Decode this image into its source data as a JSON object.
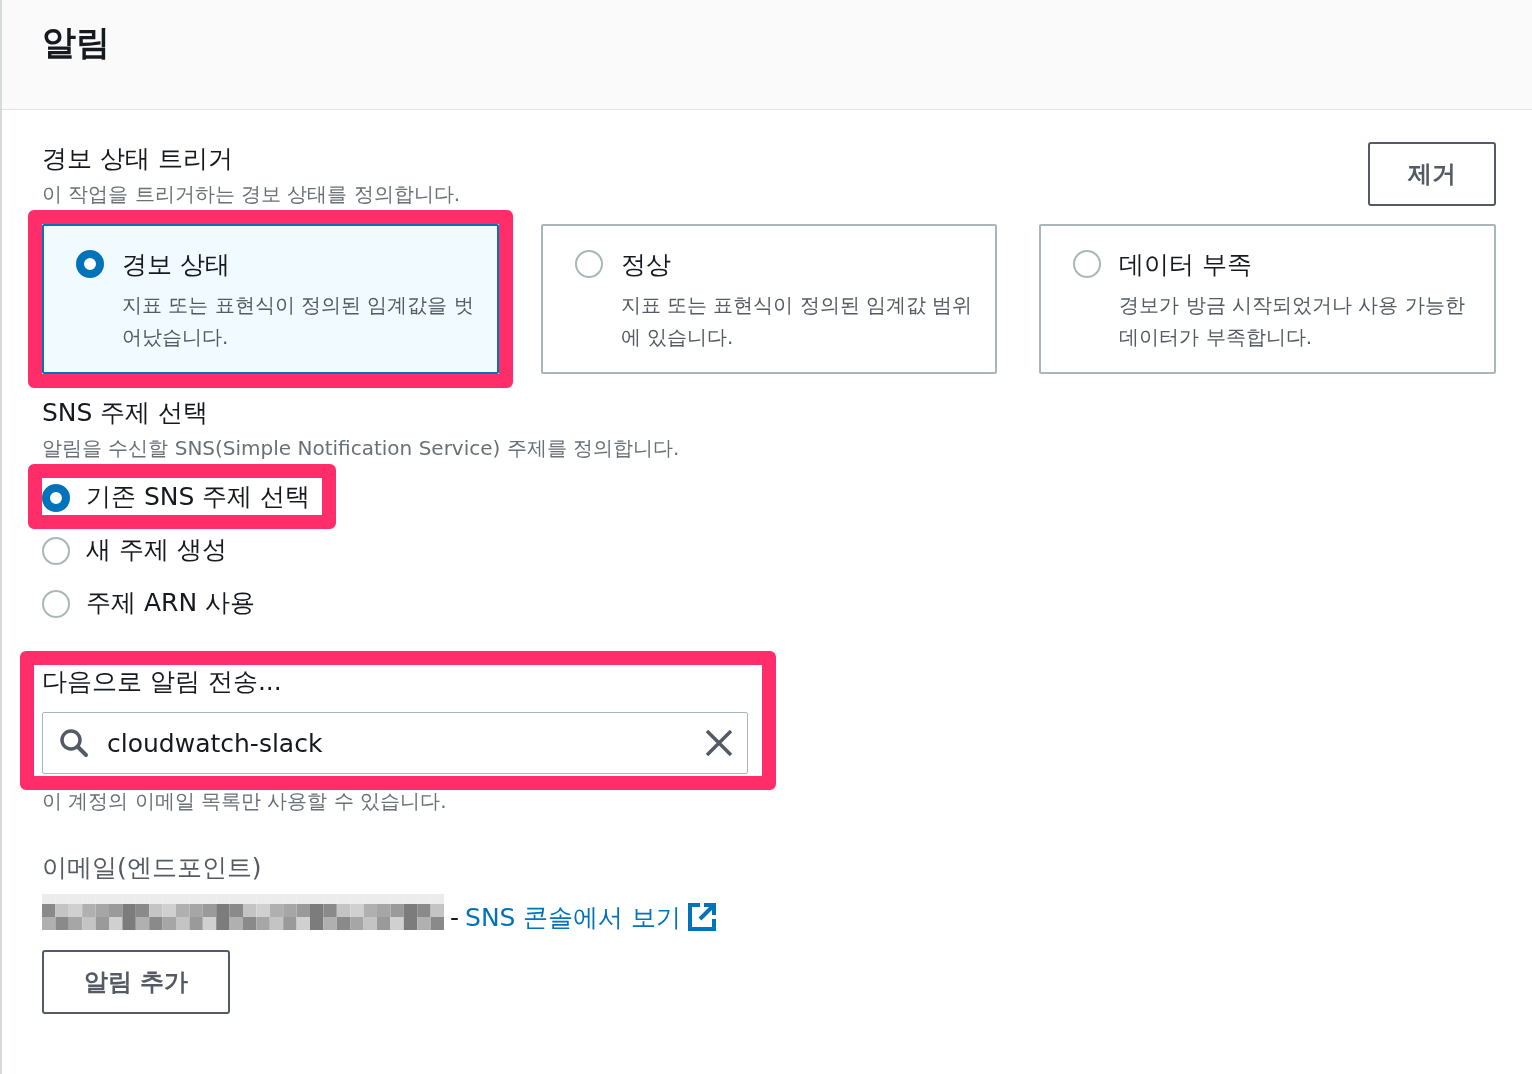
{
  "panel": {
    "title": "알림"
  },
  "trigger": {
    "label": "경보 상태 트리거",
    "description": "이 작업을 트리거하는 경보 상태를 정의합니다.",
    "remove_button": "제거",
    "options": [
      {
        "title": "경보 상태",
        "description": "지표 또는 표현식이 정의된 임계값을 벗어났습니다.",
        "selected": true,
        "highlighted": true
      },
      {
        "title": "정상",
        "description": "지표 또는 표현식이 정의된 임계값 범위에 있습니다.",
        "selected": false,
        "highlighted": false
      },
      {
        "title": "데이터 부족",
        "description": "경보가 방금 시작되었거나 사용 가능한 데이터가 부족합니다.",
        "selected": false,
        "highlighted": false
      }
    ]
  },
  "sns_topic": {
    "label": "SNS 주제 선택",
    "description": "알림을 수신할 SNS(Simple Notification Service) 주제를 정의합니다.",
    "options": [
      {
        "label": "기존 SNS 주제 선택",
        "selected": true,
        "highlighted": true
      },
      {
        "label": "새 주제 생성",
        "selected": false,
        "highlighted": false
      },
      {
        "label": "주제 ARN 사용",
        "selected": false,
        "highlighted": false
      }
    ]
  },
  "send_to": {
    "label": "다음으로 알림 전송...",
    "value": "cloudwatch-slack",
    "highlighted": true,
    "hint": "이 계정의 이메일 목록만 사용할 수 있습니다."
  },
  "email": {
    "label": "이메일(엔드포인트)",
    "separator": "-",
    "link": "SNS 콘솔에서 보기"
  },
  "add_button": "알림 추가"
}
